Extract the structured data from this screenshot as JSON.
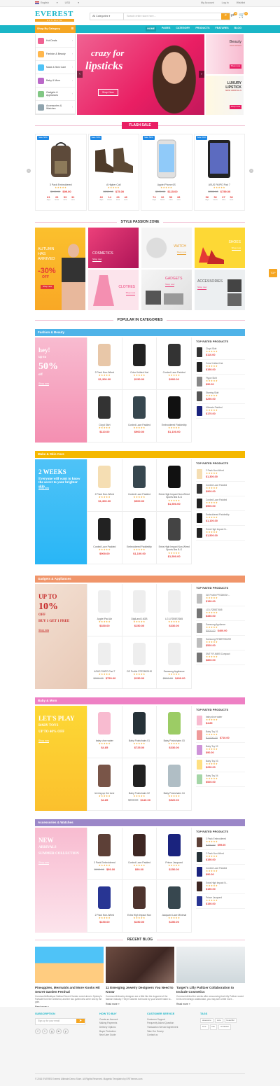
{
  "topbar": {
    "lang": "English",
    "currency": "USD",
    "account": "My Account",
    "login": "Log In",
    "wishlist": "Wishlist"
  },
  "header": {
    "logo": "EVEREST",
    "logo_sub": "ULTIMATE",
    "category_select": "All Categories",
    "search_placeholder": "Search entire store here...",
    "cart_count": "0",
    "compare_count": "0"
  },
  "nav": {
    "all_category": "Shop By Category",
    "items": [
      "HOME",
      "PAGES",
      "CATEGORY",
      "PRODUCTS",
      "FEATURES",
      "BLOG"
    ]
  },
  "sidebar": {
    "items": [
      {
        "label": "Hot Deals",
        "color": "#f06292"
      },
      {
        "label": "Fashion & Beauty",
        "color": "#ffb74d"
      },
      {
        "label": "Make & Skin Care",
        "color": "#4fc3f7"
      },
      {
        "label": "Baby & Mom",
        "color": "#ba68c8"
      },
      {
        "label": "Gadgets & Appliances",
        "color": "#81c784"
      },
      {
        "label": "Accessories & Watches",
        "color": "#90a4ae"
      }
    ]
  },
  "hero": {
    "line1": "crazy for",
    "line2": "lipsticks",
    "button": "Shop Now",
    "banner1": {
      "title": "Beauty",
      "sub": "NEW RISES",
      "btn": "Shop now"
    },
    "banner2": {
      "title": "LUXURY LIPSTICK",
      "sub": "NEW ARRIVALS",
      "btn": "Shop now"
    }
  },
  "flash": {
    "title": "FLASH SALE",
    "tag": "Sale 50%",
    "items": [
      {
        "name": "3 Pack Embroidered",
        "old": "$190.00",
        "price": "$99.00",
        "cd": [
          "81",
          "23",
          "53",
          "32"
        ]
      },
      {
        "name": "A Higher Call",
        "old": "$150.00",
        "price": "$75.00",
        "cd": [
          "62",
          "14",
          "26",
          "46"
        ]
      },
      {
        "name": "Apple iPhone 6S",
        "old": "$200.00",
        "price": "$115.00",
        "cd": [
          "74",
          "32",
          "59",
          "28"
        ]
      },
      {
        "name": "ASUS PAIPO Pad 7",
        "old": "$900.00",
        "price": "$759.00",
        "cd": [
          "56",
          "52",
          "07",
          "52"
        ]
      }
    ],
    "cd_labels": [
      "days",
      "hours",
      "mins",
      "secs"
    ],
    "stars": "★★★★★"
  },
  "zone": {
    "title": "STYLE PASSION ZONE",
    "tiles": [
      {
        "t": "AUTUMN HAS ARRIVED",
        "t2": "-30%",
        "t3": "OFF",
        "btn": "Shop now"
      },
      {
        "t": "COSMETICS",
        "btn": "Shop now"
      },
      {
        "t": "WATCH",
        "btn": "Shop now"
      },
      {
        "t": "SHOES",
        "btn": "Shop now"
      },
      {
        "t": "CLOTHES",
        "btn": "Shop now"
      },
      {
        "t": "GADGETS",
        "btn": "Shop now"
      },
      {
        "t": "ACCESSORIES",
        "btn": "Shop now"
      }
    ]
  },
  "popular": {
    "title": "POPULAR IN CATEGORIES",
    "top_rated": "TOP RATED PRODUCTS",
    "stars": "★★★★★",
    "cats": [
      {
        "name": "Fashion & Beauty",
        "color": "#4fb3e8",
        "banner": {
          "l1": "hey!",
          "l2": "up to",
          "l3": "50%",
          "l4": "off",
          "btn": "Shop now"
        },
        "grid": [
          {
            "n": "2 Pack Non-Wired",
            "p": "$1,300.00"
          },
          {
            "n": "Color Knitted Hat",
            "p": "$150.00"
          },
          {
            "n": "Corded Lace Padded",
            "p": "$900.00"
          },
          {
            "n": "Cloyd Skirt",
            "p": "$110.00"
          },
          {
            "n": "Corded Lace Padded",
            "p": "$900.00"
          },
          {
            "n": "Embroidered Paddedtip",
            "p": "$1,100.00"
          }
        ],
        "top": [
          {
            "n": "Cloyd Skirt",
            "p": "$110.00"
          },
          {
            "n": "Color Knitted Hat",
            "p": "$150.00"
          },
          {
            "n": "Flyjoe Skirt",
            "p": "$90.00"
          },
          {
            "n": "Starring Skirt",
            "p": "$250.00"
          },
          {
            "n": "Ultimate Padded",
            "p": "$170.00"
          }
        ]
      },
      {
        "name": "Make & Skin Care",
        "color": "#f5b800",
        "banner": {
          "l1": "2 WEEKS",
          "l2": "Everyone will want to know the secret to your brighter skin",
          "btn": "Shop now"
        },
        "grid": [
          {
            "n": "2 Pack Non-Wired",
            "p": "$1,300.00"
          },
          {
            "n": "Corded Lace Padded",
            "p": "$900.00"
          },
          {
            "n": "Extra High Impact Non-Wired Sports Bra B-G",
            "p": "$1,500.00"
          },
          {
            "n": "Corded Lace Padded",
            "p": "$900.00"
          },
          {
            "n": "Embroidered Paddedtip",
            "p": "$1,100.00"
          },
          {
            "n": "Extra High Impact Non-Wired Sports Bra B-G",
            "p": "$1,500.00"
          }
        ],
        "top": [
          {
            "n": "2 Pack Non-Wired",
            "p": "$1,300.00"
          },
          {
            "n": "Corded Lace Padded",
            "p": "$900.00"
          },
          {
            "n": "Corded Lace Padded",
            "p": "$900.00"
          },
          {
            "n": "Embroidered Paddedtip",
            "p": "$1,100.00"
          },
          {
            "n": "Extra High Impact N...",
            "p": "$1,500.00"
          }
        ]
      },
      {
        "name": "Gadgets & Appliances",
        "color": "#f0956a",
        "banner": {
          "l1": "UP TO",
          "l2": "10%",
          "l3": "OFF",
          "l4": "BUY 1 GET 1 FREE",
          "btn": "Shop now"
        },
        "grid": [
          {
            "n": "Apple iPad Air",
            "p": "$330.00"
          },
          {
            "n": "DigiLand 16GB",
            "p": "$150.00"
          },
          {
            "n": "LG LF255ST665",
            "p": "$330.00"
          },
          {
            "n": "ASUS PAIPO Pad 7",
            "o": "$900.00",
            "p": "$759.00"
          },
          {
            "n": "GE Profile PFE28KSHS",
            "p": "$150.00"
          },
          {
            "n": "Samsung Appliance",
            "o": "$500.00",
            "p": "$400.00"
          }
        ],
        "top": [
          {
            "n": "GE Profile PFE28KSH...",
            "p": "$150.00"
          },
          {
            "n": "LG LF255ST665",
            "p": "$330.00"
          },
          {
            "n": "Samsung Appliance",
            "o": "$500.00",
            "p": "$400.00"
          },
          {
            "n": "Samsung RF28R7551SR",
            "p": "$520.00"
          },
          {
            "n": "SMT RF-M495 Compact",
            "p": "$860.00"
          }
        ]
      },
      {
        "name": "Baby & Mom",
        "color": "#ee80c4",
        "banner": {
          "l1": "LET'S PLAY",
          "l2": "BABY TOYS",
          "l3": "UP TO 40% OFF",
          "btn": "Shop now"
        },
        "grid": [
          {
            "n": "baby shoe water",
            "p": "$4.85"
          },
          {
            "n": "Baby Pushchairs 01",
            "p": "$725.00"
          },
          {
            "n": "Baby Pushchairs 03",
            "p": "$330.00"
          },
          {
            "n": "leering up the tone",
            "p": "$4.85"
          },
          {
            "n": "Baby Pushchairs 02",
            "o": "$200.00",
            "p": "$140.00"
          },
          {
            "n": "Baby Pushchairs 04",
            "p": "$520.00"
          }
        ],
        "top": [
          {
            "n": "baby shoe water",
            "p": "$4.85"
          },
          {
            "n": "Baby Toy 01",
            "o": "$1,000.00",
            "p": "$710.00"
          },
          {
            "n": "Baby Toy 02",
            "p": "$90.00"
          },
          {
            "n": "Baby Toy 03",
            "p": "$250.00"
          },
          {
            "n": "Baby Toy 04",
            "p": "$520.00"
          }
        ]
      },
      {
        "name": "Accessories & Watches",
        "color": "#9b87c8",
        "banner": {
          "l1": "NEW",
          "l2": "ARRIVALS",
          "l3": "SUMMER COLLECTION",
          "btn": "Shop now"
        },
        "grid": [
          {
            "n": "3 Pack Embroidered",
            "o": "$190.00",
            "p": "$99.00"
          },
          {
            "n": "Corded Lace Padded",
            "p": "$90.00"
          },
          {
            "n": "Prince Jacquard",
            "p": "$150.00"
          },
          {
            "n": "2 Pack Non-Wired",
            "p": "$150.00"
          },
          {
            "n": "Extra High Impact Non",
            "p": "$150.00"
          },
          {
            "n": "Jacquard Lace Minimal",
            "p": "$150.00"
          }
        ],
        "top": [
          {
            "n": "3 Pack Embroidered",
            "o": "$190.00",
            "p": "$99.00"
          },
          {
            "n": "2 Pack Non-Wired",
            "p": "$150.00"
          },
          {
            "n": "Corded Lace Padded",
            "p": "$90.00"
          },
          {
            "n": "Extra High Impact N...",
            "p": "$150.00"
          },
          {
            "n": "Prince Jacquard",
            "p": "$150.00"
          }
        ]
      }
    ]
  },
  "blog": {
    "title": "RECENT BLOG",
    "read_more": "Read more »",
    "posts": [
      {
        "t": "Pineapples, Mermaids and More Kooks Hit Secret Garden Festival",
        "e": "Commonh&Boutique Naltrad Secret Garden event drew in Sydney's Fairvale from the weekend, and the two gulfed who were lost by the gate."
      },
      {
        "t": "11 Emerging Jewelry Designers You Need to Know",
        "e": "Commonh&Jewelry designer are a little like the dogcrest of the fashion industry. They're adored but found by your secret hatch to..."
      },
      {
        "t": "Target's Lilly Pulitzer Collaboration to Include Cosmetics",
        "e": "Commonh&Just the weeks after announcing that Lilly Pulitzer would be its next design collaborator, you may see a little more..."
      }
    ]
  },
  "footer": {
    "subscribe": {
      "title": "SUBSCRIPTION",
      "placeholder": "Sign up for your email"
    },
    "social": [
      "f",
      "t",
      "g",
      "in",
      "p"
    ],
    "howto": {
      "title": "HOW TO BUY",
      "items": [
        "Create an Account",
        "Making Payments",
        "Delivery Options",
        "Buyer Protection",
        "New User Guide"
      ]
    },
    "service": {
      "title": "CUSTOMER SERVICE",
      "items": [
        "Customer Support",
        "Frequently Asked Question",
        "Transaction Service Agreement",
        "Take Our Survey",
        "Contact us"
      ]
    },
    "tags": {
      "title": "TAGS",
      "items": [
        "awesome",
        "cute",
        "beautiful",
        "love",
        "like",
        "smilestar"
      ]
    },
    "copyright": "© 2016 EVERES Everest Ultimate Demo Store. All Rights Reserved. Magento Templates by ERThemes.com"
  },
  "fab": "TOP"
}
